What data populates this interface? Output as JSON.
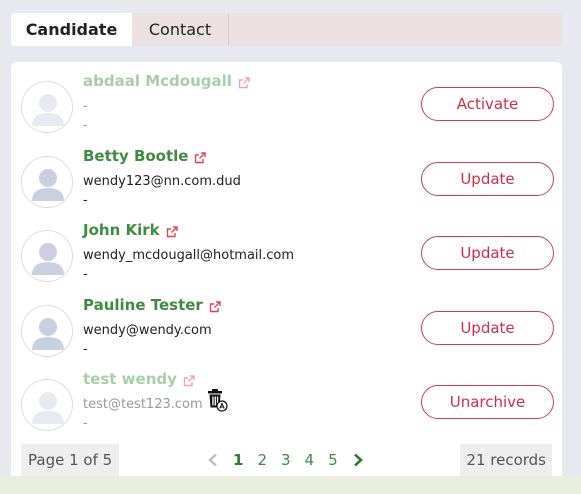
{
  "tabs": [
    {
      "label": "Candidate",
      "active": true
    },
    {
      "label": "Contact",
      "active": false
    }
  ],
  "candidates": [
    {
      "name": "abdaal Mcdougall",
      "email": "-",
      "extra": "-",
      "action": "Activate",
      "dimmed": true,
      "archived_icon": false
    },
    {
      "name": "Betty Bootle",
      "email": "wendy123@nn.com.dud",
      "extra": "-",
      "action": "Update",
      "dimmed": false,
      "archived_icon": false
    },
    {
      "name": "John Kirk",
      "email": "wendy_mcdougall@hotmail.com",
      "extra": "-",
      "action": "Update",
      "dimmed": false,
      "archived_icon": false
    },
    {
      "name": "Pauline Tester",
      "email": "wendy@wendy.com",
      "extra": "-",
      "action": "Update",
      "dimmed": false,
      "archived_icon": false
    },
    {
      "name": "test wendy",
      "email": "test@test123.com",
      "extra": "-",
      "action": "Unarchive",
      "dimmed": true,
      "archived_icon": true
    }
  ],
  "pagination": {
    "page_info": "Page 1 of 5",
    "pages": [
      "1",
      "2",
      "3",
      "4",
      "5"
    ],
    "current": "1",
    "records": "21 records"
  },
  "icons": {
    "external_link": "external-link-icon",
    "avatar": "user-avatar-icon",
    "trash": "archive-trash-icon",
    "prev": "chevron-left-icon",
    "next": "chevron-right-icon"
  },
  "colors": {
    "name_green": "#3d8c40",
    "accent_red": "#cf2d4a",
    "ext_icon": "#e0455f"
  }
}
